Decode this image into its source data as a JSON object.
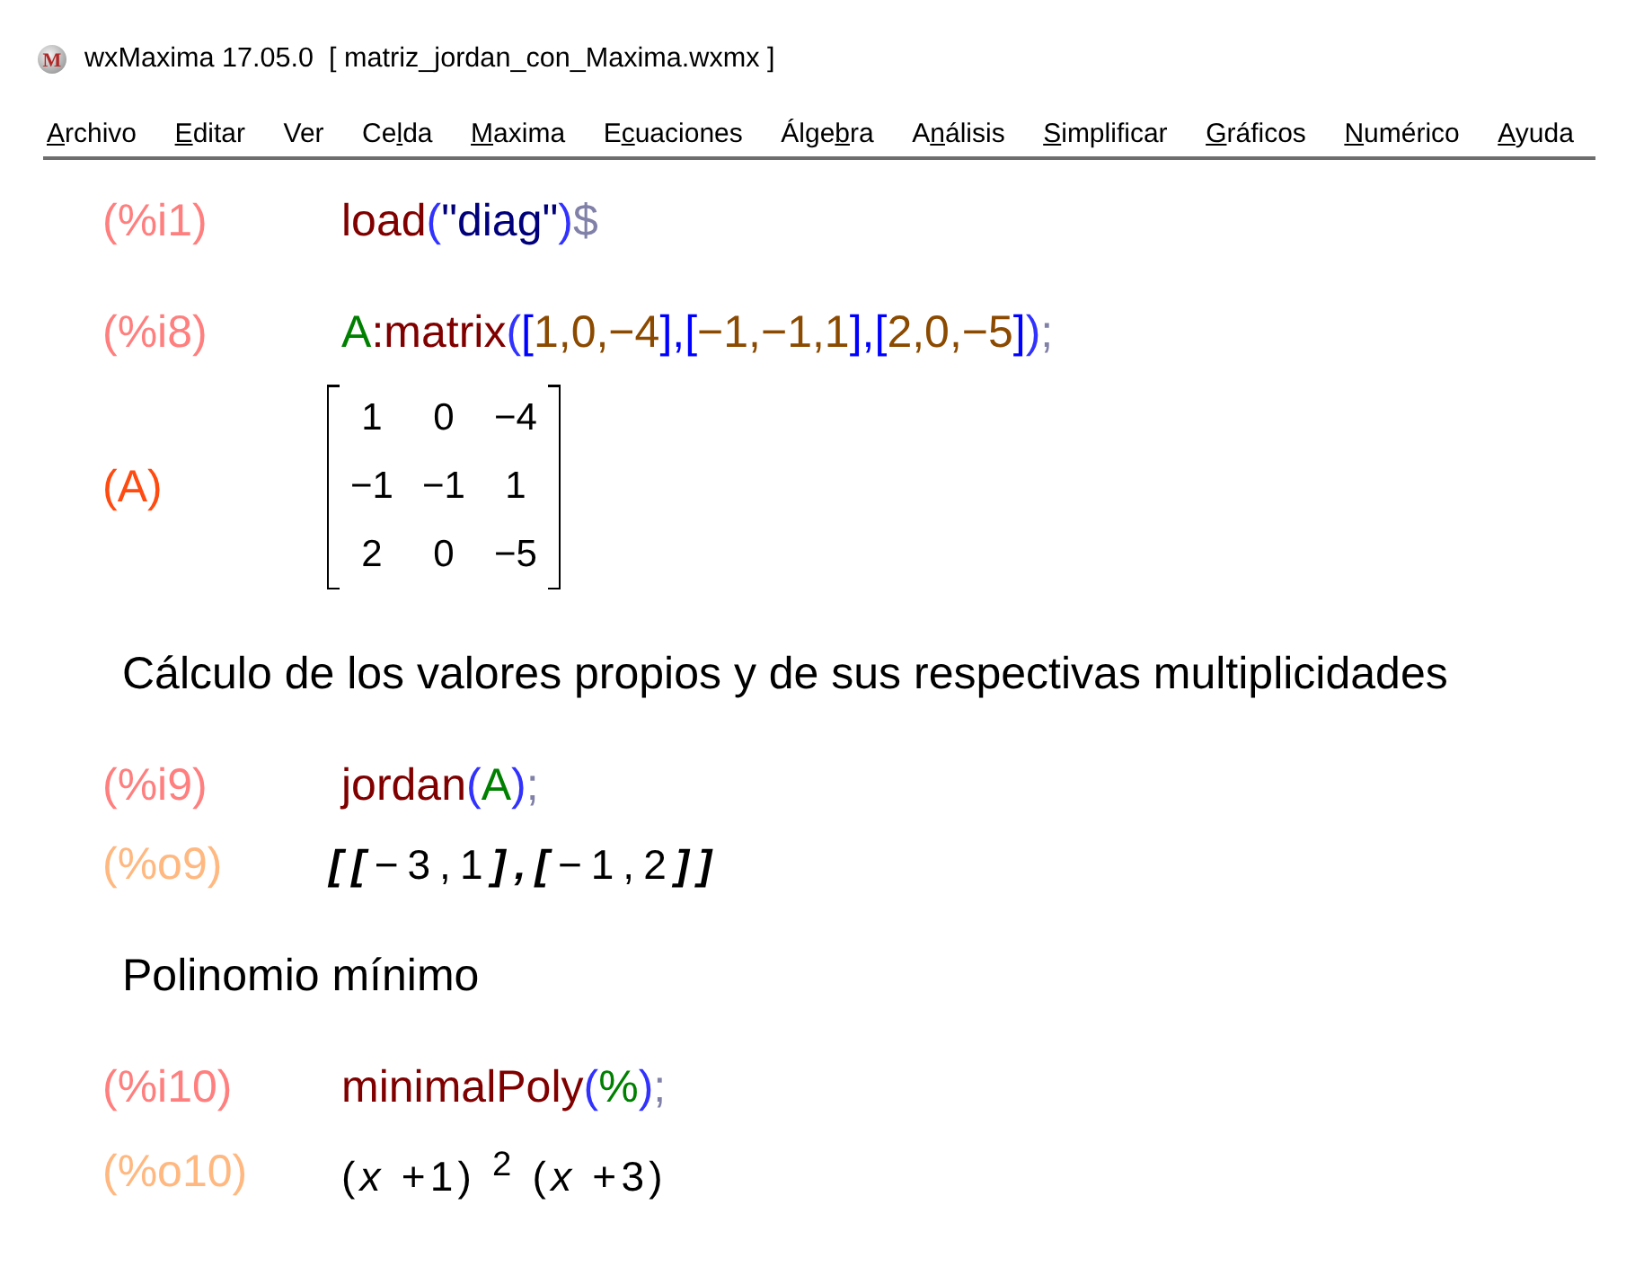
{
  "window": {
    "logo_text": "M",
    "title": "wxMaxima 17.05.0  [ matriz_jordan_con_Maxima.wxmx ]"
  },
  "menu_bar": [
    {
      "key": "A",
      "post": "rchivo"
    },
    {
      "key": "E",
      "post": "ditar"
    },
    {
      "pre": "Ver"
    },
    {
      "pre": "Ce",
      "key": "l",
      "post": "da"
    },
    {
      "key": "M",
      "post": "axima"
    },
    {
      "pre": "E",
      "key": "c",
      "post": "uaciones"
    },
    {
      "pre": "Álge",
      "key": "b",
      "post": "ra"
    },
    {
      "pre": "A",
      "key": "n",
      "post": "álisis"
    },
    {
      "key": "S",
      "post": "implificar"
    },
    {
      "key": "G",
      "post": "ráficos"
    },
    {
      "key": "N",
      "post": "umérico"
    },
    {
      "key": "A",
      "post": "yuda"
    }
  ],
  "cells": [
    {
      "kind": "input",
      "label": "(%i1)",
      "code": [
        {
          "text": "load",
          "kind": "function"
        },
        {
          "text": "(",
          "kind": "paren"
        },
        {
          "text": "\"diag\"",
          "kind": "string"
        },
        {
          "text": ")",
          "kind": "paren"
        },
        {
          "text": "$",
          "kind": "terminator"
        }
      ]
    },
    {
      "kind": "input",
      "label": "(%i8)",
      "code": [
        {
          "text": "A",
          "kind": "variable"
        },
        {
          "text": ":",
          "kind": "operator"
        },
        {
          "text": "matrix",
          "kind": "function"
        },
        {
          "text": "(",
          "kind": "paren"
        },
        {
          "text": "[",
          "kind": "bracket"
        },
        {
          "text": "1,0,−4",
          "kind": "number"
        },
        {
          "text": "],[",
          "kind": "bracket"
        },
        {
          "text": "−1,−1,1",
          "kind": "number"
        },
        {
          "text": "],[",
          "kind": "bracket"
        },
        {
          "text": "2,0,−5",
          "kind": "number"
        },
        {
          "text": "]",
          "kind": "bracket"
        },
        {
          "text": ")",
          "kind": "paren"
        },
        {
          "text": ";",
          "kind": "terminator"
        }
      ],
      "output": {
        "kind": "matrix",
        "label": "(A)",
        "named_label": true,
        "rows": [
          [
            "1",
            "0",
            "−4"
          ],
          [
            "−1",
            "−1",
            "1"
          ],
          [
            "2",
            "0",
            "−5"
          ]
        ]
      }
    },
    {
      "kind": "text",
      "text": "Cálculo de los valores propios y de sus respectivas multiplicidades"
    },
    {
      "kind": "input",
      "label": "(%i9)",
      "code": [
        {
          "text": "jordan",
          "kind": "function"
        },
        {
          "text": "(",
          "kind": "paren"
        },
        {
          "text": "A",
          "kind": "variable"
        },
        {
          "text": ")",
          "kind": "paren"
        },
        {
          "text": ";",
          "kind": "terminator"
        }
      ],
      "output": {
        "kind": "list",
        "label": "(%o9)",
        "named_label": false,
        "tokens": [
          {
            "text": "[[",
            "kind": "bracket"
          },
          {
            "text": "−3,1",
            "kind": "number"
          },
          {
            "text": "],[",
            "kind": "bracket"
          },
          {
            "text": "−1,2",
            "kind": "number"
          },
          {
            "text": "]]",
            "kind": "bracket"
          }
        ]
      }
    },
    {
      "kind": "text",
      "text": "Polinomio mínimo"
    },
    {
      "kind": "input",
      "label": "(%i10)",
      "code": [
        {
          "text": "minimalPoly",
          "kind": "function"
        },
        {
          "text": "(",
          "kind": "paren"
        },
        {
          "text": "%",
          "kind": "variable"
        },
        {
          "text": ")",
          "kind": "paren"
        },
        {
          "text": ";",
          "kind": "terminator"
        }
      ],
      "output": {
        "kind": "math",
        "label": "(%o10)",
        "named_label": false,
        "text": "(*x* +1) $^{2}$ (*x* +3)"
      }
    }
  ]
}
